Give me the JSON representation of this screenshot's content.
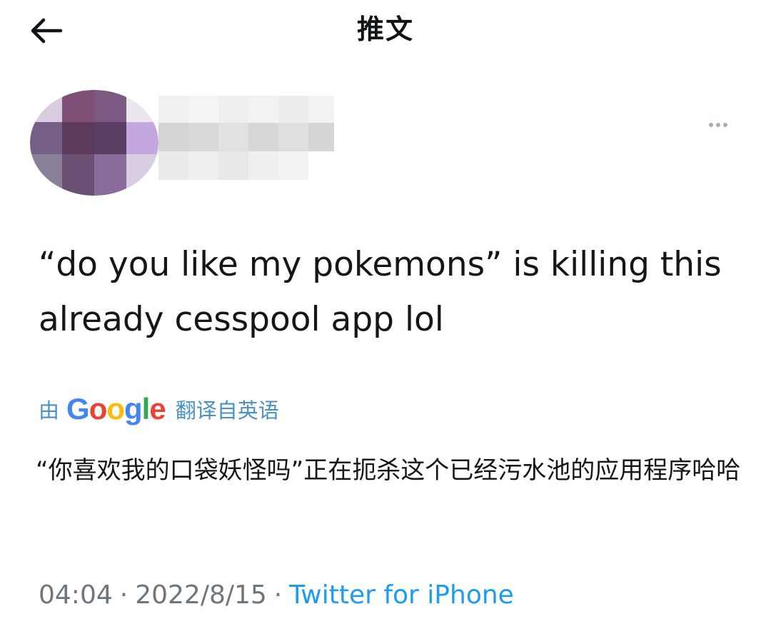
{
  "header": {
    "title": "推文",
    "back_icon": "arrow-left-icon"
  },
  "author": {
    "avatar": "blurred-avatar",
    "more_icon": "more-horizontal-icon"
  },
  "tweet": {
    "text": "“do you like my pokemons” is killing this already cesspool app lol"
  },
  "translation": {
    "by_label": "由",
    "provider_letters": [
      "G",
      "o",
      "o",
      "g",
      "l",
      "e"
    ],
    "provider_colors": [
      "#4285f4",
      "#ea4335",
      "#fbbc05",
      "#4285f4",
      "#34a853",
      "#ea4335"
    ],
    "from_label": "翻译自英语",
    "text": "“你喜欢我的口袋妖怪吗”正在扼杀这个已经污水池的应用程序哈哈"
  },
  "meta": {
    "time": "04:04",
    "separator": "·",
    "date": "2022/8/15",
    "source": "Twitter for iPhone"
  },
  "colors": {
    "accent": "#1d9bf0",
    "text": "#14171a",
    "muted": "#6e767d"
  }
}
